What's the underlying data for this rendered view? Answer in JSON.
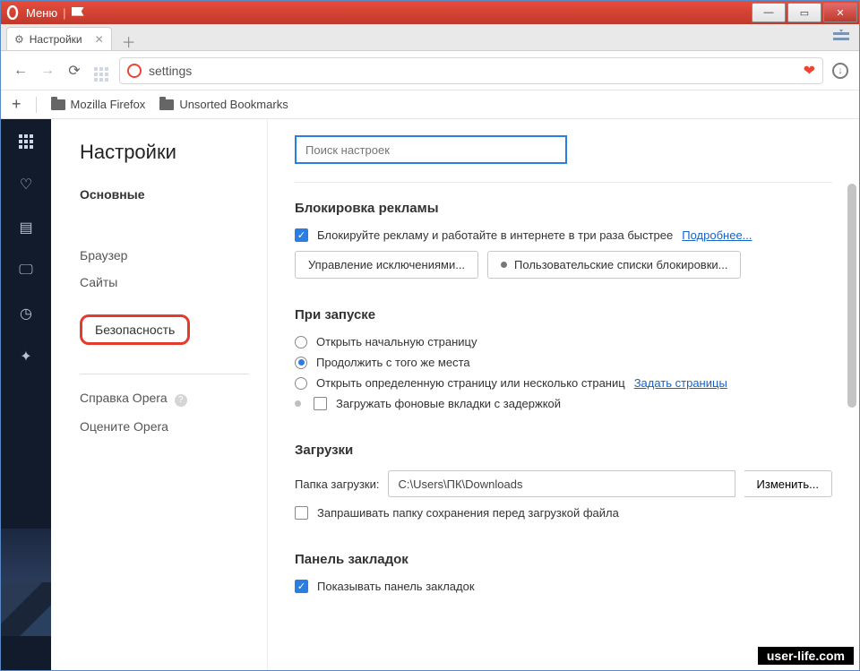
{
  "titlebar": {
    "menu": "Меню"
  },
  "tab": {
    "title": "Настройки"
  },
  "address": {
    "value": "settings"
  },
  "bookmarks": {
    "firefox": "Mozilla Firefox",
    "unsorted": "Unsorted Bookmarks"
  },
  "nav": {
    "heading": "Настройки",
    "group": "Основные",
    "browser": "Браузер",
    "sites": "Сайты",
    "security": "Безопасность",
    "help": "Справка Opera",
    "rate": "Оцените Opera"
  },
  "search": {
    "placeholder": "Поиск настроек"
  },
  "adblock": {
    "title": "Блокировка рекламы",
    "check_label": "Блокируйте рекламу и работайте в интернете в три раза быстрее",
    "more": "Подробнее...",
    "btn_exceptions": "Управление исключениями...",
    "btn_lists": "Пользовательские списки блокировки..."
  },
  "startup": {
    "title": "При запуске",
    "opt1": "Открыть начальную страницу",
    "opt2": "Продолжить с того же места",
    "opt3": "Открыть определенную страницу или несколько страниц",
    "opt3_link": "Задать страницы",
    "bg_tabs": "Загружать фоновые вкладки с задержкой"
  },
  "downloads": {
    "title": "Загрузки",
    "folder_label": "Папка загрузки:",
    "folder_value": "C:\\Users\\ПК\\Downloads",
    "change": "Изменить...",
    "ask": "Запрашивать папку сохранения перед загрузкой файла"
  },
  "bm_panel": {
    "title": "Панель закладок",
    "show": "Показывать панель закладок"
  },
  "watermark": "user-life.com"
}
